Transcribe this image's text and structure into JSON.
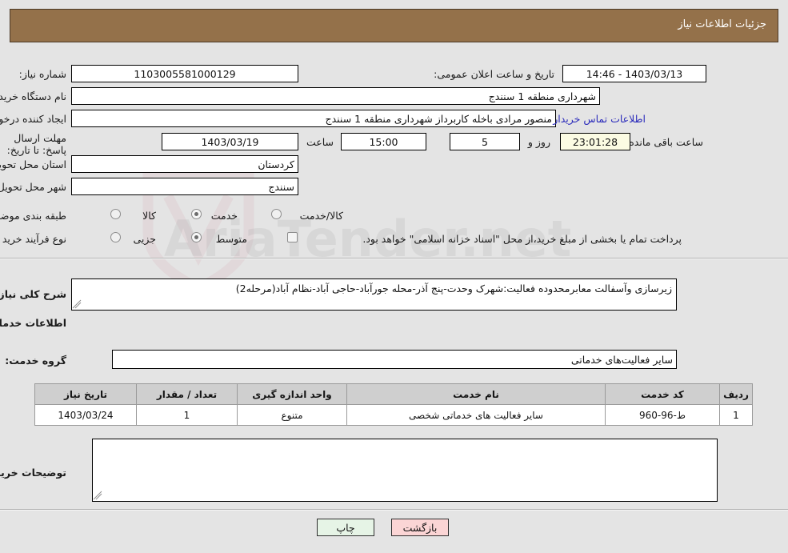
{
  "header": {
    "title": "جزئیات اطلاعات نیاز"
  },
  "form": {
    "need_number_label": "شماره نیاز:",
    "need_number_value": "1103005581000129",
    "public_announce_label": "تاریخ و ساعت اعلان عمومی:",
    "public_announce_value": "1403/03/13 - 14:46",
    "buyer_org_label": "نام دستگاه خریدار:",
    "buyer_org_value": "شهرداری منطقه 1 سنندج",
    "creator_label": "ایجاد کننده درخواست:",
    "creator_value": "منصور مرادی باخله کاربرداز شهرداری منطقه 1 سنندج",
    "contact_link": "اطلاعات تماس خریدار",
    "deadline_label": "مهلت ارسال پاسخ: تا تاریخ:",
    "deadline_date": "1403/03/19",
    "hour_label": "ساعت",
    "deadline_time": "15:00",
    "days_value": "5",
    "days_label": "روز و",
    "countdown_value": "23:01:28",
    "remaining_label": "ساعت باقی مانده",
    "province_label": "استان محل تحویل:",
    "province_value": "کردستان",
    "city_label": "شهر محل تحویل:",
    "city_value": "سنندج",
    "category_label": "طبقه بندی موضوعی:",
    "category_options": [
      "کالا",
      "خدمت",
      "کالا/خدمت"
    ],
    "category_selected": "خدمت",
    "process_label": "نوع فرآیند خرید :",
    "process_options": [
      "جزیی",
      "متوسط"
    ],
    "process_selected": "متوسط",
    "payment_note": "پرداخت تمام یا بخشی از مبلغ خرید،از محل \"اسناد خزانه اسلامی\" خواهد بود.",
    "payment_checked": false
  },
  "summary": {
    "label": "شرح کلی نیاز:",
    "value": "زیرسازی وآسفالت معابرمحدوده فعالیت:شهرک وحدت-پنج آذر-محله جورآباد-حاجی آباد-نظام آباد(مرحله2)"
  },
  "services": {
    "section_title": "اطلاعات خدمات مورد نیاز",
    "group_label": "گروه خدمت:",
    "group_value": "سایر فعالیت‌های خدماتی",
    "columns": [
      "ردیف",
      "کد خدمت",
      "نام خدمت",
      "واحد اندازه گیری",
      "تعداد / مقدار",
      "تاریخ نیاز"
    ],
    "rows": [
      {
        "row": "1",
        "code": "ط-96-960",
        "name": "سایر فعالیت های خدماتی شخصی",
        "unit": "متنوع",
        "qty": "1",
        "date": "1403/03/24"
      }
    ]
  },
  "notes": {
    "label": "توضیحات خریدار;",
    "value": ""
  },
  "footer": {
    "print_label": "چاپ",
    "back_label": "بازگشت"
  },
  "watermark": {
    "text": "AriaTender.net"
  },
  "colors": {
    "header_bg": "#94714a",
    "page_bg": "#e4e4e4",
    "link": "#2b2bbb",
    "print_btn": "#e6f4e6",
    "back_btn": "#fbd5d5",
    "countdown_bg": "#fbfbe3"
  }
}
